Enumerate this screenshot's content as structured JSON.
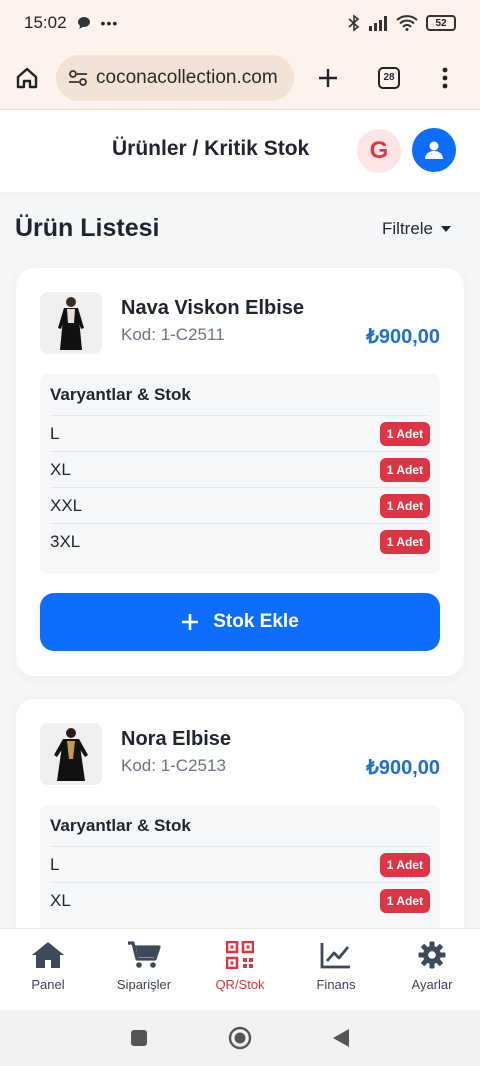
{
  "status_bar": {
    "time": "15:02",
    "battery": "52"
  },
  "browser": {
    "url": "coconacollection.com",
    "tab_count": "28"
  },
  "header": {
    "title": "Ürünler / Kritik Stok",
    "avatar_letter": "G"
  },
  "page": {
    "heading": "Ürün Listesi",
    "filter_label": "Filtrele"
  },
  "products": [
    {
      "name": "Nava Viskon Elbise",
      "code": "Kod: 1-C2511",
      "price": "₺900,00",
      "variants_title": "Varyantlar & Stok",
      "variants": [
        {
          "size": "L",
          "stock": "1 Adet"
        },
        {
          "size": "XL",
          "stock": "1 Adet"
        },
        {
          "size": "XXL",
          "stock": "1 Adet"
        },
        {
          "size": "3XL",
          "stock": "1 Adet"
        }
      ],
      "add_stock_label": "Stok Ekle"
    },
    {
      "name": "Nora Elbise",
      "code": "Kod: 1-C2513",
      "price": "₺900,00",
      "variants_title": "Varyantlar & Stok",
      "variants": [
        {
          "size": "L",
          "stock": "1 Adet"
        },
        {
          "size": "XL",
          "stock": "1 Adet"
        }
      ]
    }
  ],
  "bottom_nav": [
    {
      "label": "Panel",
      "icon": "home-icon"
    },
    {
      "label": "Siparişler",
      "icon": "cart-icon"
    },
    {
      "label": "QR/Stok",
      "icon": "qr-icon",
      "active": true
    },
    {
      "label": "Finans",
      "icon": "chart-line-icon"
    },
    {
      "label": "Ayarlar",
      "icon": "gear-icon"
    }
  ],
  "colors": {
    "primary": "#0d6efd",
    "danger": "#dc3545",
    "price": "#1f6fd0",
    "active_nav": "#d63a3f"
  }
}
